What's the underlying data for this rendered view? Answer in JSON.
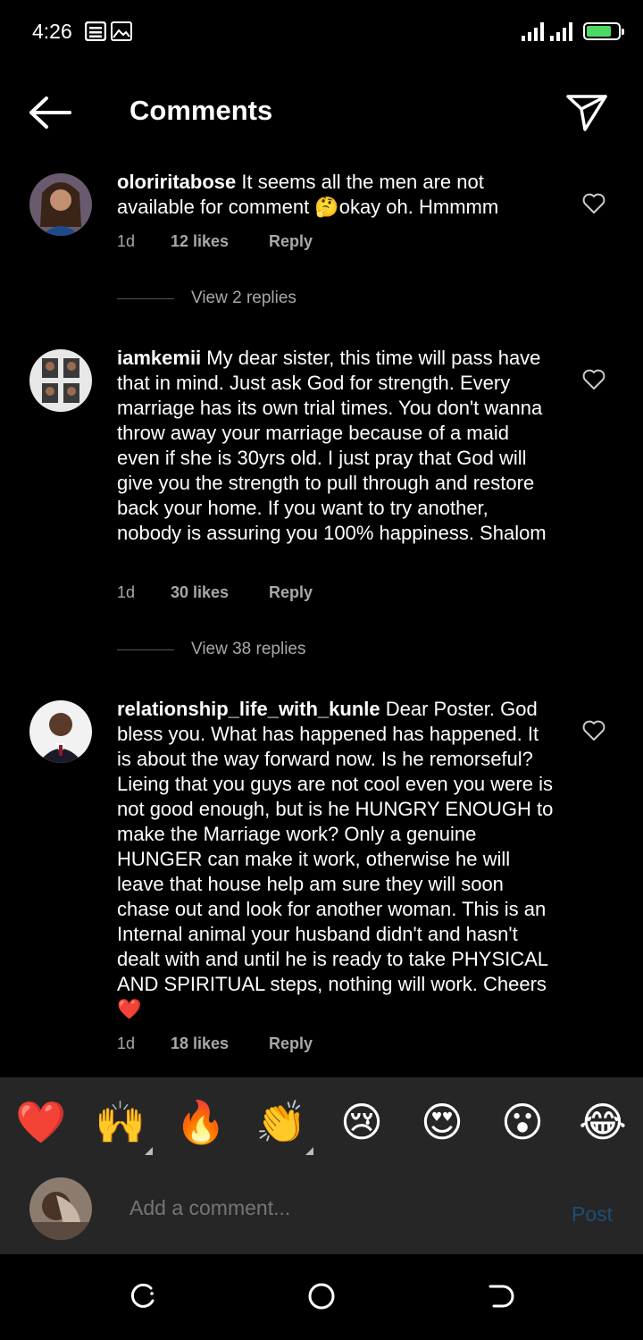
{
  "status_bar": {
    "time": "4:26",
    "icons": [
      "notification-icon",
      "gallery-icon",
      "signal-icon",
      "battery-icon"
    ],
    "battery_level": 0.8,
    "battery_color": "#4cd964"
  },
  "header": {
    "title": "Comments",
    "back_icon": "arrow-left-icon",
    "send_icon": "paper-plane-icon"
  },
  "comments": [
    {
      "username": "oloriritabose",
      "text": " It seems all the men are not available for comment 🤔okay oh. Hmmmm",
      "time": "1d",
      "likes": "12 likes",
      "reply": "Reply",
      "view_replies": "View 2 replies"
    },
    {
      "username": "iamkemii",
      "text": " My dear sister, this time will pass have that in mind. Just ask God for strength. Every marriage has its own trial times. You don't wanna throw away your marriage because of a maid even if she is 30yrs old. I just pray that God will give you the strength to pull through and restore back your home. If you want to try another, nobody is assuring you 100% happiness. Shalom",
      "time": "1d",
      "likes": "30 likes",
      "reply": "Reply",
      "view_replies": "View 38 replies"
    },
    {
      "username": "relationship_life_with_kunle",
      "text": " Dear Poster. God bless you. What has happened has happened. It is about the way forward now. Is he remorseful? Lieing that you guys are not cool even you were is not good enough, but is he HUNGRY ENOUGH to make the Marriage work? Only a genuine HUNGER can make it work, otherwise he will leave that house help am sure they will soon chase out and look for another woman. This is an Internal animal your husband didn't and hasn't dealt with and until he is ready to take PHYSICAL AND SPIRITUAL steps, nothing will work. Cheers❤️",
      "time": "1d",
      "likes": "18 likes",
      "reply": "Reply"
    }
  ],
  "emoji_bar": [
    "❤️",
    "🙌",
    "🔥",
    "👏",
    "😢",
    "😍",
    "😮",
    "😂"
  ],
  "composer": {
    "placeholder": "Add a comment...",
    "post_label": "Post",
    "post_color": "#1d4e7a"
  },
  "nav_bar": [
    "recents-icon",
    "home-icon",
    "back-icon"
  ]
}
